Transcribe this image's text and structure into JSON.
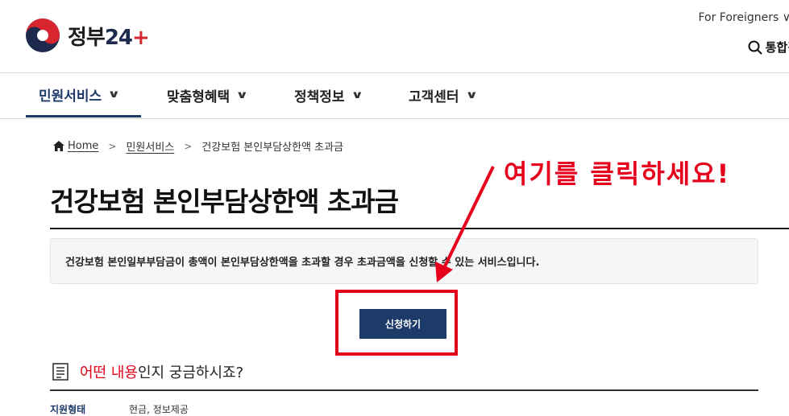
{
  "header": {
    "logo_text": "정부",
    "logo_num": "24",
    "logo_plus": "+",
    "foreigners": "For Foreigners",
    "search_label": "통합검"
  },
  "nav": {
    "items": [
      {
        "label": "민원서비스"
      },
      {
        "label": "맞춤형혜택"
      },
      {
        "label": "정책정보"
      },
      {
        "label": "고객센터"
      }
    ],
    "chevron": "∨"
  },
  "breadcrumb": {
    "home": "Home",
    "level1": "민원서비스",
    "current": "건강보험 본인부담상한액 초과금",
    "sep": ">"
  },
  "page": {
    "title": "건강보험 본인부담상한액 초과금",
    "description": "건강보험 본인일부부담금이 총액이 본인부담상한액을 초과할 경우 초과금액을 신청할 수 있는 서비스입니다.",
    "apply_button": "신청하기"
  },
  "annotation": {
    "text": "여기를 클릭하세요!",
    "color": "#e6001c"
  },
  "question": {
    "red_part": "어떤 내용",
    "rest": "인지 궁금하시죠?"
  },
  "info_row": {
    "label": "지원형태",
    "value": "현금, 정보제공"
  },
  "colors": {
    "primary": "#1d3b69",
    "accent_red": "#e3001b"
  }
}
